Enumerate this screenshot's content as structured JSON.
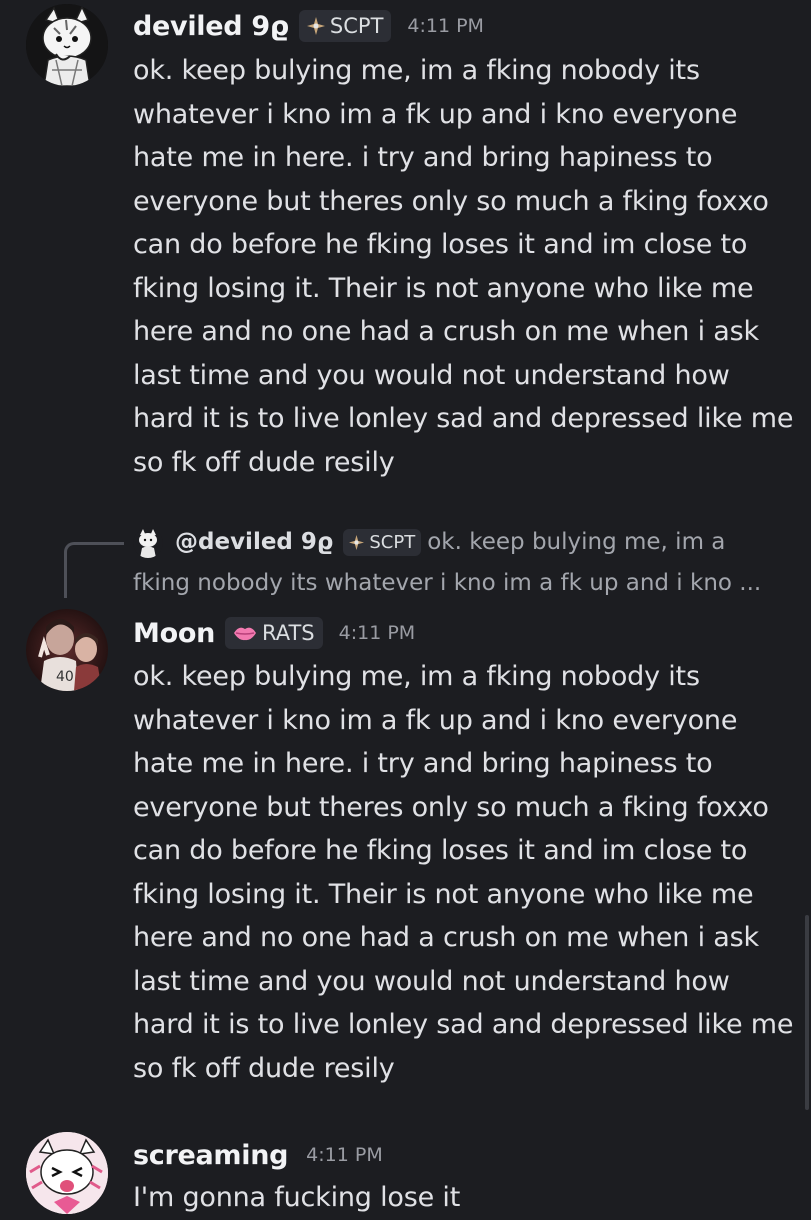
{
  "messages": [
    {
      "username": "deviled 9ϱ",
      "tag": "SCPT",
      "tag_icon": "diamond-compass-icon",
      "timestamp": "4:11 PM",
      "text": "ok. keep bulying me, im a fking nobody its whatever i kno im a fk up and i kno everyone hate me in here. i try and bring hapiness to everyone but theres only so much a fking foxxo can do before he fking loses it and im close to fking losing it. Their is not anyone who like me here and no one had a crush on me when i ask last time and you would not understand how hard it is to live lonley sad and depressed like me so fk off dude resily"
    },
    {
      "reply": {
        "username": "@deviled 9ϱ",
        "tag": "SCPT",
        "text_line1": "ok. keep bulying me, im a",
        "text_line2": "fking nobody its whatever i kno im a fk up and i kno ..."
      },
      "username": "Moon",
      "tag": "RATS",
      "tag_icon": "lips-icon",
      "timestamp": "4:11 PM",
      "text": "ok. keep bulying me, im a fking nobody its whatever i kno im a fk up and i kno everyone hate me in here. i try and bring hapiness to everyone but theres only so much a fking foxxo can do before he fking loses it and im close to fking losing it. Their is not anyone who like me here and no one had a crush on me when i ask last time and you would not understand how hard it is to live lonley sad and depressed like me so fk off dude resily"
    },
    {
      "username": "screaming",
      "timestamp": "4:11 PM",
      "text": "I'm gonna fucking lose it"
    }
  ],
  "colors": {
    "background": "#1c1d21",
    "username": "#f2f3f5",
    "timestamp": "#9a9ca3",
    "tag_bg": "#2c2e35",
    "lips": "#f27ab0"
  }
}
